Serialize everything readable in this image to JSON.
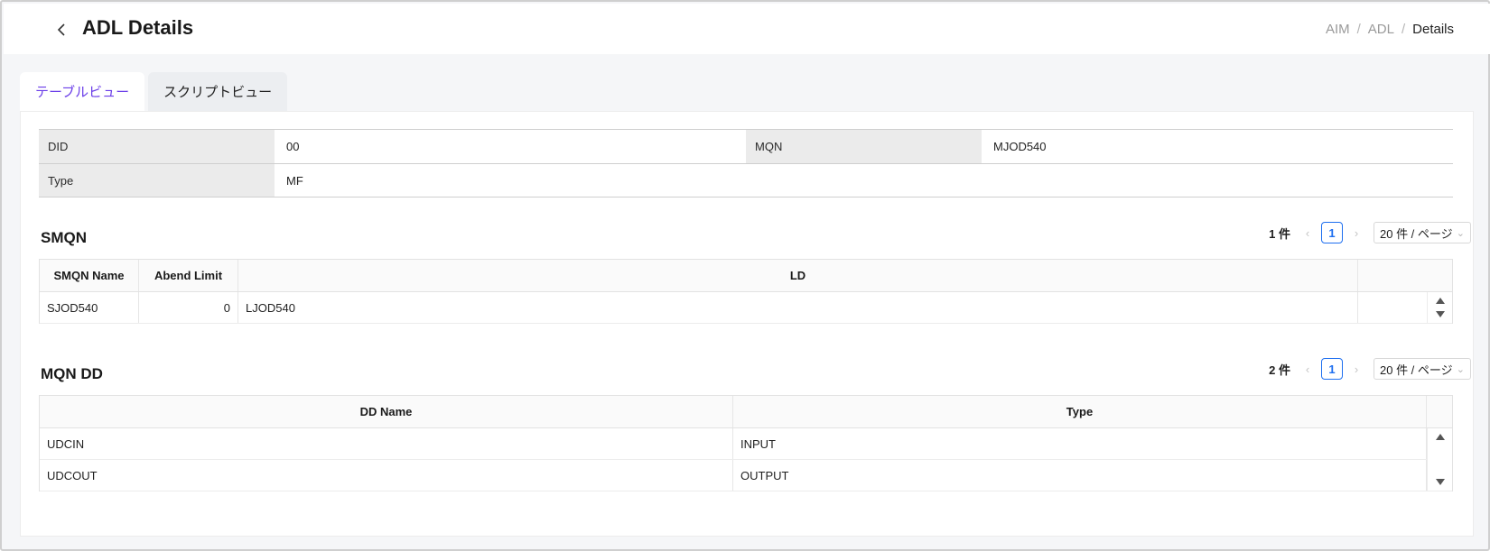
{
  "header": {
    "title": "ADL Details",
    "breadcrumb": [
      "AIM",
      "ADL",
      "Details"
    ]
  },
  "tabs": [
    {
      "label": "テーブルビュー",
      "active": true
    },
    {
      "label": "スクリプトビュー",
      "active": false
    }
  ],
  "info": {
    "did_label": "DID",
    "did_value": "00",
    "mqn_label": "MQN",
    "mqn_value": "MJOD540",
    "type_label": "Type",
    "type_value": "MF"
  },
  "smqn": {
    "title": "SMQN",
    "count": "1 件",
    "page": "1",
    "page_size": "20 件 / ページ",
    "columns": [
      "SMQN Name",
      "Abend Limit",
      "LD"
    ],
    "rows": [
      [
        "SJOD540",
        "0",
        "LJOD540"
      ]
    ]
  },
  "mqn_dd": {
    "title": "MQN DD",
    "count": "2 件",
    "page": "1",
    "page_size": "20 件 / ページ",
    "columns": [
      "DD Name",
      "Type"
    ],
    "rows": [
      [
        "UDCIN",
        "INPUT"
      ],
      [
        "UDCOUT",
        "OUTPUT"
      ]
    ]
  },
  "colors": {
    "accent": "#6a3de8",
    "pager_active": "#1e6ff0"
  },
  "icons": {
    "back": "chevron-left-icon",
    "prev": "chevron-left-icon",
    "next": "chevron-right-icon",
    "select": "chevron-down-icon"
  }
}
